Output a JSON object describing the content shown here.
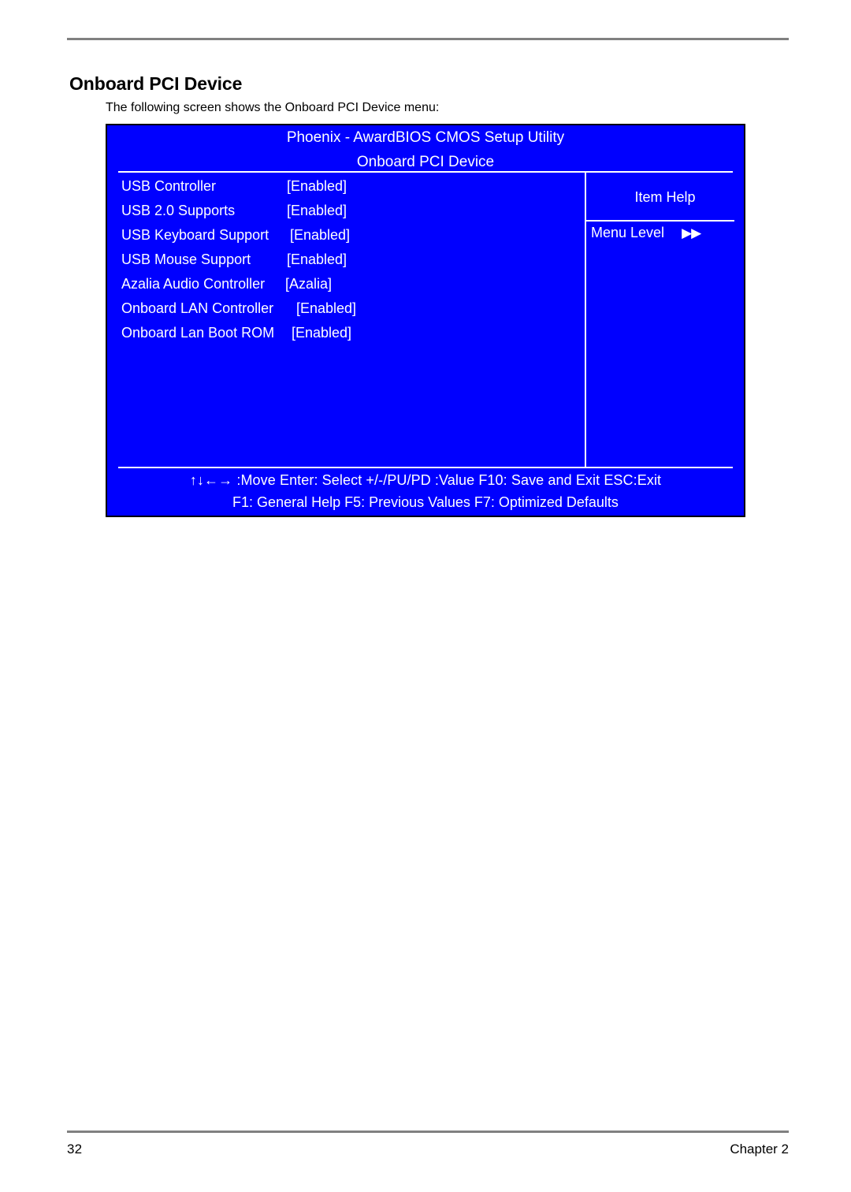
{
  "document": {
    "section_heading": "Onboard PCI Device",
    "intro_text": "The following screen shows the Onboard PCI Device menu:",
    "page_number": "32",
    "chapter_label": "Chapter 2"
  },
  "bios": {
    "colors": {
      "screen_background": "#0000FF",
      "text": "#FFFFFF",
      "border": "#000000",
      "page_rule": "#808080"
    },
    "title_line1": "Phoenix - AwardBIOS CMOS Setup Utility",
    "title_line2": "Onboard PCI Device",
    "settings": [
      {
        "label": "USB Controller",
        "value": "[Enabled]",
        "value_x": 228
      },
      {
        "label": "USB 2.0 Supports",
        "value": "[Enabled]",
        "value_x": 228
      },
      {
        "label": "USB Keyboard Support",
        "value": "[Enabled]",
        "value_x": 232
      },
      {
        "label": "USB Mouse Support",
        "value": "[Enabled]",
        "value_x": 228
      },
      {
        "label": "Azalia Audio Controller",
        "value": "[Azalia]",
        "value_x": 226
      },
      {
        "label": "Onboard LAN Controller",
        "value": "[Enabled]",
        "value_x": 240
      },
      {
        "label": "Onboard Lan Boot ROM",
        "value": "[Enabled]",
        "value_x": 234
      }
    ],
    "item_help": {
      "title": "Item Help",
      "menu_level_label": "Menu Level",
      "menu_level_arrows": "▶▶"
    },
    "footer": {
      "line1": "↑↓←→ :Move  Enter: Select   +/-/PU/PD :Value  F10: Save and Exit ESC:Exit",
      "line2": "F1: General Help   F5: Previous Values   F7: Optimized Defaults"
    }
  }
}
